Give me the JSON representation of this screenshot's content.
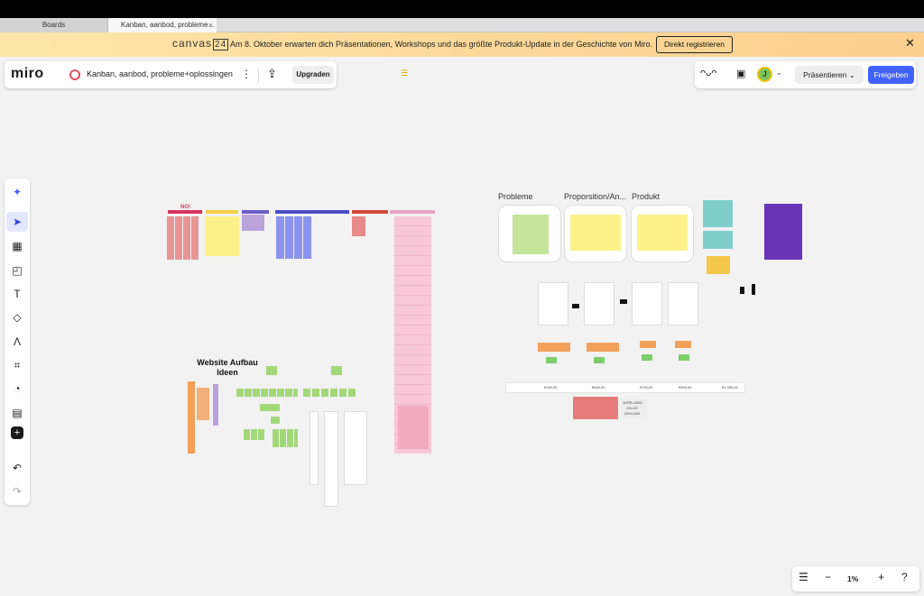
{
  "browser": {
    "tabs": [
      {
        "label": "Boards"
      },
      {
        "label": "Kanban, aanbod, probleme…",
        "close": "×"
      }
    ]
  },
  "banner": {
    "logo_text": "canvas",
    "logo_year": "24",
    "message": "Am 8. Oktober erwarten dich Präsentationen, Workshops und das größte Produkt-Update in der Geschichte von Miro.",
    "cta_label": "Direkt registrieren",
    "close_icon": "✕"
  },
  "header": {
    "logo": "miro",
    "board_title": "Kanban, aanbod, probleme+oplossingen",
    "more_icon": "⋮",
    "export_icon": "⇪",
    "upgrade_label": "Upgraden",
    "present_label": "Präsentieren ⌄",
    "share_label": "Freigeben",
    "avatar_initial": "J",
    "chevron": "⌄"
  },
  "toolbar": {
    "tools": [
      {
        "name": "ai-assist-tool",
        "glyph": "✦"
      },
      {
        "name": "select-tool",
        "glyph": "➤"
      },
      {
        "name": "templates-tool",
        "glyph": "▦"
      },
      {
        "name": "sticky-note-tool",
        "glyph": "◰"
      },
      {
        "name": "text-tool",
        "glyph": "T"
      },
      {
        "name": "shapes-tool",
        "glyph": "◇"
      },
      {
        "name": "pen-tool",
        "glyph": "Λ"
      },
      {
        "name": "frame-tool",
        "glyph": "⌗"
      },
      {
        "name": "color-tool",
        "glyph": "◔"
      },
      {
        "name": "comment-tool",
        "glyph": "▤"
      },
      {
        "name": "add-tool",
        "glyph": "+"
      },
      {
        "name": "undo-tool",
        "glyph": "↶"
      },
      {
        "name": "redo-tool",
        "glyph": "↷"
      }
    ]
  },
  "zoom": {
    "list_icon": "☰",
    "minus": "−",
    "value": "1%",
    "plus": "+",
    "help": "?"
  },
  "canvas": {
    "no_label": "NO!",
    "website_title": "Website Aufbau Ideen",
    "section_probleme": "Probleme",
    "section_proporsition": "Proporsition/An...",
    "section_produkt": "Produkt",
    "formula_lines": [
      "1KPR=2000",
      "1%=20",
      "25%=500"
    ],
    "prices": [
      "€150,00",
      "€600,00",
      "€750,00",
      "€900,00",
      "€1.350,00"
    ]
  }
}
